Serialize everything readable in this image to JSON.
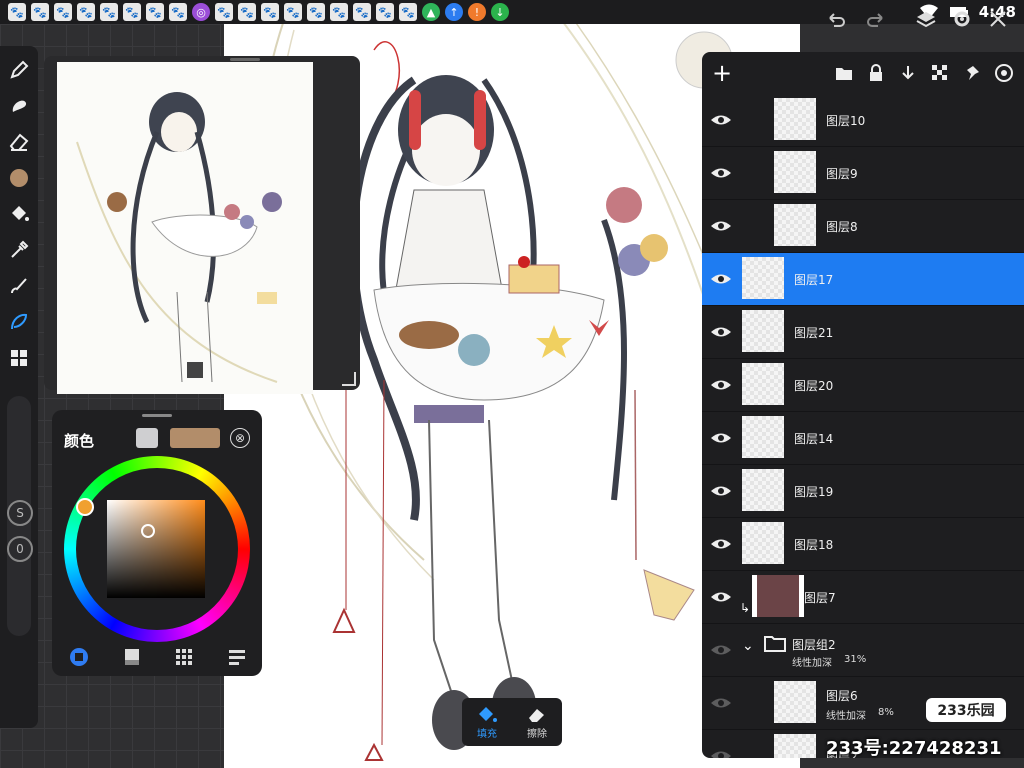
{
  "status_bar": {
    "time": "4:48",
    "notifications": [
      "🐾",
      "🐾",
      "🐾",
      "🐾",
      "🐾",
      "🐾",
      "🐾",
      "🐾",
      "◎",
      "🐾",
      "🐾",
      "🐾",
      "🐾",
      "🐾",
      "🐾",
      "🐾",
      "🐾",
      "🐾",
      "▲",
      "↑",
      "!",
      "↓"
    ]
  },
  "toolbar": {
    "tools": [
      "pen-icon",
      "smudge-icon",
      "eraser-icon",
      "color-swatch",
      "fill-bucket-icon",
      "eyedropper-icon",
      "brush-icon",
      "lasso-icon",
      "grid-icon"
    ],
    "active_tool": "lasso-icon",
    "size_label": "S",
    "opacity_label": "0"
  },
  "color_panel": {
    "title": "颜色",
    "secondary_color": "#cfcfd1",
    "primary_color": "#b28d6a",
    "close": "⊗"
  },
  "layers_panel": {
    "layers": [
      {
        "name": "图层10",
        "indent": "sub",
        "visible": true,
        "active": false
      },
      {
        "name": "图层9",
        "indent": "sub",
        "visible": true,
        "active": false
      },
      {
        "name": "图层8",
        "indent": "sub",
        "visible": true,
        "active": false
      },
      {
        "name": "图层17",
        "indent": "top",
        "visible": true,
        "active": true
      },
      {
        "name": "图层21",
        "indent": "top",
        "visible": true,
        "active": false
      },
      {
        "name": "图层20",
        "indent": "top",
        "visible": true,
        "active": false
      },
      {
        "name": "图层14",
        "indent": "top",
        "visible": true,
        "active": false
      },
      {
        "name": "图层19",
        "indent": "top",
        "visible": true,
        "active": false
      },
      {
        "name": "图层18",
        "indent": "top",
        "visible": true,
        "active": false
      },
      {
        "name": "图层7",
        "indent": "clip",
        "visible": true,
        "active": false
      },
      {
        "name": "图层组2",
        "mode": "线性加深",
        "opacity": "31%",
        "indent": "group",
        "visible": false,
        "active": false
      },
      {
        "name": "图层6",
        "mode": "线性加深",
        "opacity": "8%",
        "indent": "sub",
        "visible": false,
        "active": false
      },
      {
        "name": "图层2",
        "indent": "sub",
        "visible": false,
        "active": false
      }
    ]
  },
  "action_bar": {
    "fill_label": "填充",
    "erase_label": "擦除"
  },
  "watermark": {
    "logo": "233乐园",
    "id_text": "233号:227428231"
  },
  "colors": {
    "accent": "#1e7cf2",
    "panel_bg": "#1e1e20"
  }
}
